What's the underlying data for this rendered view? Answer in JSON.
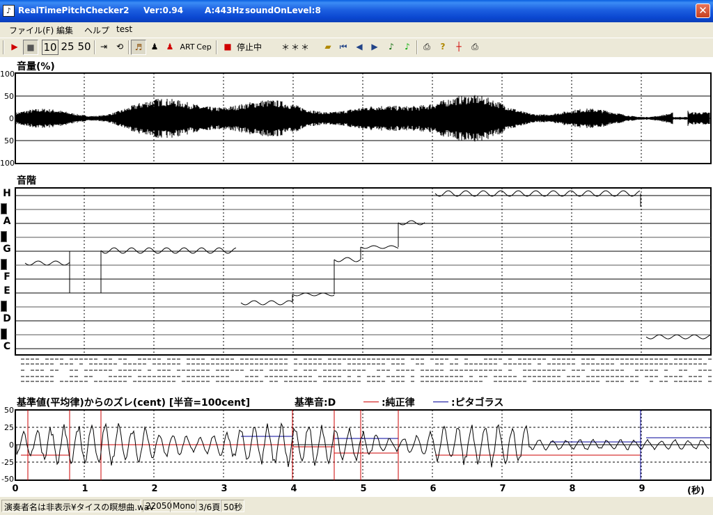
{
  "title": {
    "app_name": "RealTimePitchChecker2",
    "version": "Ver:0.94",
    "a_freq": "A:443Hz",
    "sound_level": "soundOnLevel:8"
  },
  "menu": [
    "ファイル(F)",
    "編集",
    "ヘルプ",
    "test"
  ],
  "toolbar": {
    "speed_10": "10",
    "speed_25": "25",
    "speed_50": "50",
    "art_label": "ART",
    "cep_label": "Cep",
    "status_text": "停止中",
    "pitch_readout": "＊＊＊"
  },
  "volume_panel": {
    "title": "音量(%)",
    "y_ticks": [
      "100",
      "50",
      "0",
      "50",
      "100"
    ]
  },
  "scale_panel": {
    "title": "音階",
    "notes": [
      "H",
      "A",
      "G",
      "F",
      "E",
      "D",
      "C"
    ]
  },
  "deviation_panel": {
    "title": "基準値(平均律)からのズレ(cent) [半音=100cent]",
    "base_note": "基準音:D",
    "legend_just": ":純正律",
    "legend_pyth": ":ピタゴラス",
    "y_ticks": [
      "50",
      "25",
      "0",
      "-25",
      "-50"
    ],
    "x_ticks": [
      "0",
      "1",
      "2",
      "3",
      "4",
      "5",
      "6",
      "7",
      "8",
      "9"
    ],
    "x_unit": "(秒)"
  },
  "status": {
    "file": "演奏者名は非表示¥タイスの瞑想曲.wav",
    "rate": "22050",
    "channels": "Mono",
    "page": "3/6頁",
    "duration": "50秒"
  },
  "colors": {
    "title_bar": "#0a46d0",
    "just_intonation": "#cc0000",
    "pythagorean": "#000099",
    "waveform": "#000000",
    "grid": "#000000"
  },
  "icons": [
    "play-icon",
    "stop-icon",
    "jump-end-icon",
    "loop-icon",
    "violin-icon",
    "person-black-icon",
    "person-red-icon",
    "record-icon",
    "open-folder-icon",
    "first-icon",
    "prev-icon",
    "next-icon",
    "note-icon",
    "note-green-icon",
    "print-icon",
    "help-icon",
    "marker-icon",
    "print2-icon",
    "close-icon"
  ]
}
